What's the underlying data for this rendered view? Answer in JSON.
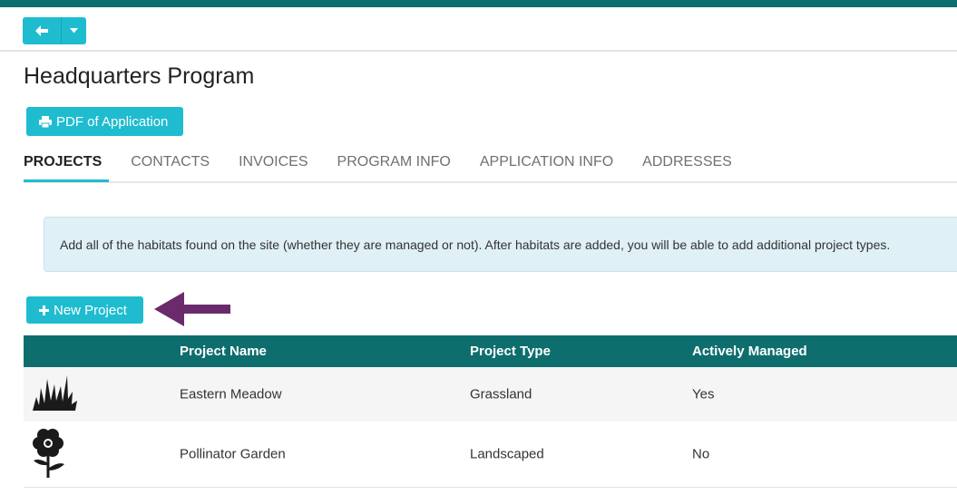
{
  "colors": {
    "accent": "#1fbcd0",
    "header_bar": "#0e6e6e",
    "alert_bg": "#dff0f7",
    "annotation_arrow": "#6b2a6b"
  },
  "nav": {
    "back_icon": "arrow-left-icon",
    "dropdown_icon": "caret-down-icon"
  },
  "page": {
    "title": "Headquarters Program",
    "pdf_button_label": "PDF of Application",
    "pdf_button_icon": "printer-icon"
  },
  "tabs": [
    {
      "label": "PROJECTS",
      "active": true
    },
    {
      "label": "CONTACTS",
      "active": false
    },
    {
      "label": "INVOICES",
      "active": false
    },
    {
      "label": "PROGRAM INFO",
      "active": false
    },
    {
      "label": "APPLICATION INFO",
      "active": false
    },
    {
      "label": "ADDRESSES",
      "active": false
    }
  ],
  "alert": {
    "text": "Add all of the habitats found on the site (whether they are managed or not). After habitats are added, you will be able to add additional project types."
  },
  "new_project": {
    "label": "New Project",
    "icon": "plus-icon"
  },
  "table": {
    "columns": [
      "",
      "Project Name",
      "Project Type",
      "Actively Managed"
    ],
    "rows": [
      {
        "icon": "grass-icon",
        "name": "Eastern Meadow",
        "type": "Grassland",
        "active": "Yes"
      },
      {
        "icon": "flower-icon",
        "name": "Pollinator Garden",
        "type": "Landscaped",
        "active": "No"
      }
    ]
  }
}
